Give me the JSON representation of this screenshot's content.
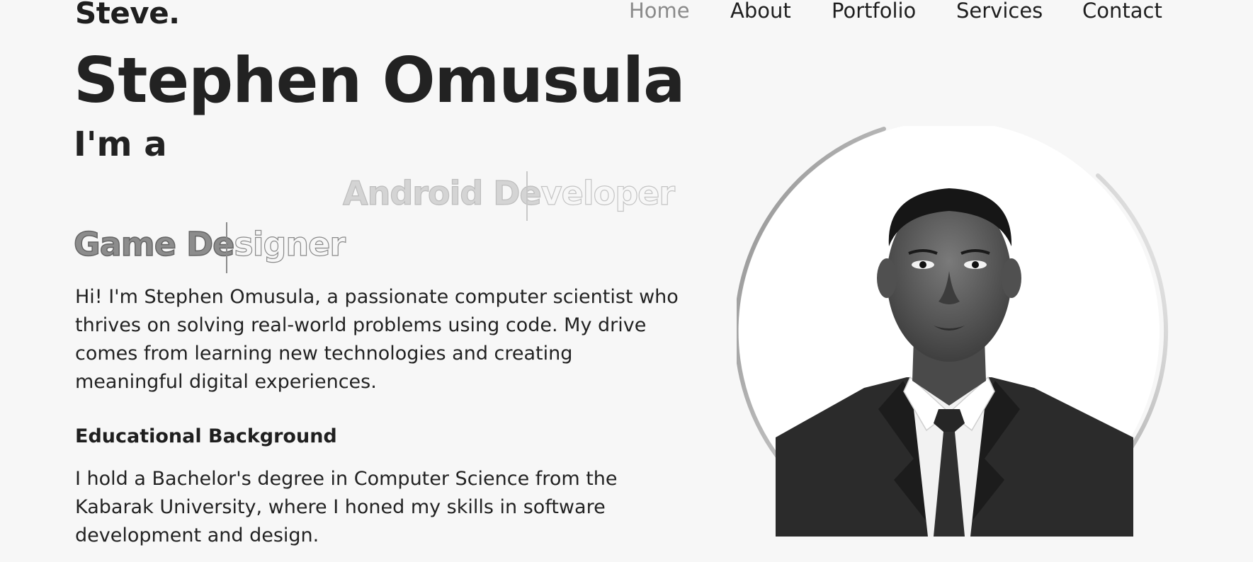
{
  "header": {
    "logo": "Steve.",
    "nav": [
      {
        "label": "Home",
        "active": true
      },
      {
        "label": "About",
        "active": false
      },
      {
        "label": "Portfolio",
        "active": false
      },
      {
        "label": "Services",
        "active": false
      },
      {
        "label": "Contact",
        "active": false
      }
    ]
  },
  "hero": {
    "name": "Stephen Omusula",
    "intro": "I'm a",
    "roles": [
      {
        "typed": "Android De",
        "remaining": "veloper"
      },
      {
        "typed": "Game De",
        "remaining": "signer"
      }
    ],
    "bio": "Hi! I'm Stephen Omusula, a passionate computer scientist who thrives on solving real-world problems using code. My drive comes from learning new technologies and creating meaningful digital experiences."
  },
  "education": {
    "heading": "Educational Background",
    "text": "I hold a Bachelor's degree in Computer Science from the Kabarak University, where I honed my skills in software development and design."
  },
  "colors": {
    "background": "#f7f7f7",
    "text": "#222222",
    "nav_active": "#8a8a8a"
  }
}
